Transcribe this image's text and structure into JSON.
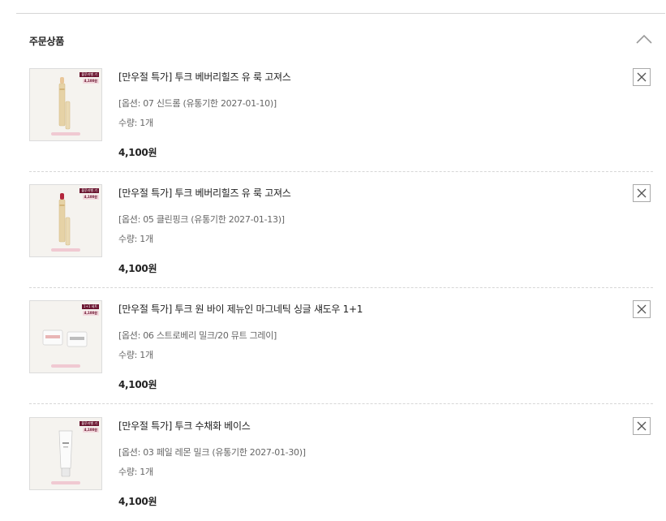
{
  "section": {
    "title": "주문상품"
  },
  "items": [
    {
      "name": "[만우절 특가] 투크 베버리힐즈 유 룩 고져스",
      "option": "[옵션: 07 신드롬 (유통기한 2027-01-10)]",
      "quantity": "수량: 1개",
      "price": "4,100원",
      "image": {
        "kind": "lip-pen",
        "tip_color": "#e9c79a",
        "badge_text": "블루라벨 기",
        "badge_price": "4,100원"
      }
    },
    {
      "name": "[만우절 특가] 투크 베버리힐즈 유 룩 고져스",
      "option": "[옵션: 05 클린핑크 (유통기한 2027-01-13)]",
      "quantity": "수량: 1개",
      "price": "4,100원",
      "image": {
        "kind": "lip-pen",
        "tip_color": "#b3263d",
        "badge_text": "블루라벨 기",
        "badge_price": "4,100원"
      }
    },
    {
      "name": "[만우절 특가] 투크 원 바이 제뉴인 마그네틱 싱글 섀도우 1+1",
      "option": "[옵션: 06 스트로베리 밀크/20 뮤트 그레이]",
      "quantity": "수량: 1개",
      "price": "4,100원",
      "image": {
        "kind": "shadow-cases",
        "tip_color": "#e8b5b5",
        "badge_text": "1+1 세트",
        "badge_price": "4,100원"
      }
    },
    {
      "name": "[만우절 특가] 투크 수채화 베이스",
      "option": "[옵션: 03 페일 레몬 밀크 (유통기한 2027-01-30)]",
      "quantity": "수량: 1개",
      "price": "4,100원",
      "image": {
        "kind": "tube",
        "tip_color": "#f2eee6",
        "badge_text": "블루라벨 기",
        "badge_price": "4,100원"
      }
    }
  ],
  "icons": {
    "collapse": "chevron-up-icon",
    "remove": "close-icon"
  },
  "colors": {
    "badge_dark": "#6b1530",
    "badge_light": "#f3d9de",
    "border": "#dcdcdc",
    "text_main": "#222222",
    "text_sub": "#666666"
  }
}
